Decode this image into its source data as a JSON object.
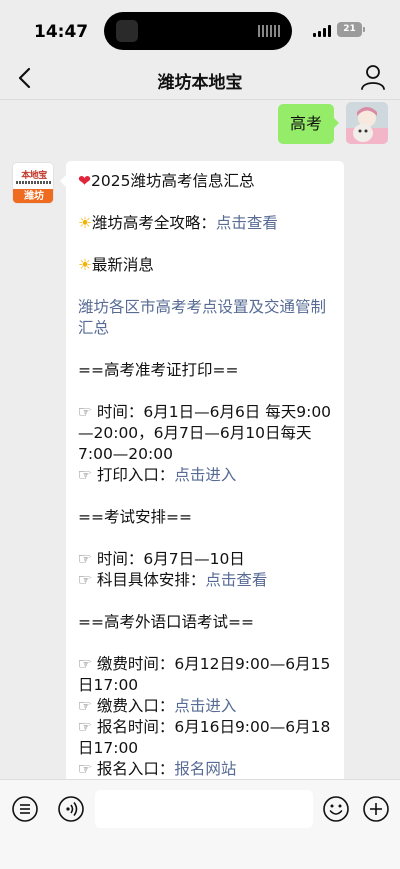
{
  "status": {
    "time": "14:47",
    "battery": "21"
  },
  "nav": {
    "title": "潍坊本地宝",
    "back_icon": "chevron-left-icon",
    "profile_icon": "person-icon"
  },
  "chat": {
    "sent_message": "高考",
    "bot_avatar": {
      "logo_text": "本地宝",
      "city_label": "潍坊"
    },
    "bot_message": {
      "heading": "2025潍坊高考信息汇总",
      "strategy_label": "潍坊高考全攻略：",
      "strategy_link": "点击查看",
      "latest_news": "最新消息",
      "exam_sites_link": "潍坊各区市高考考点设置及交通管制汇总",
      "admit_card_title": "==高考准考证打印==",
      "admit_time_label": "时间：",
      "admit_time_value": "6月1日—6月6日 每天9:00—20:00，6月7日—6月10日每天7:00—20:00",
      "print_entry_label": "打印入口：",
      "print_entry_link": "点击进入",
      "schedule_title": "==考试安排==",
      "schedule_time_label": "时间：",
      "schedule_time_value": "6月7日—10日",
      "subject_label": "科目具体安排：",
      "subject_link": "点击查看",
      "oral_title": "==高考外语口语考试==",
      "fee_time_label": "缴费时间：",
      "fee_time_value": "6月12日9:00—6月15日17:00",
      "fee_entry_label": "缴费入口：",
      "fee_entry_link": "点击进入",
      "reg_time_label": "报名时间：",
      "reg_time_value": "6月16日9:00—6月18日17:00",
      "reg_entry_label": "报名入口：",
      "reg_entry_link": "报名网站"
    }
  },
  "input_bar": {
    "text_value": "",
    "icons": [
      "menu-list-icon",
      "voice-icon",
      "emoji-icon",
      "plus-icon"
    ]
  },
  "colors": {
    "sent_bubble": "#95ec69",
    "link": "#576b95",
    "background": "#ededed",
    "logo_orange": "#ef6b1f"
  }
}
